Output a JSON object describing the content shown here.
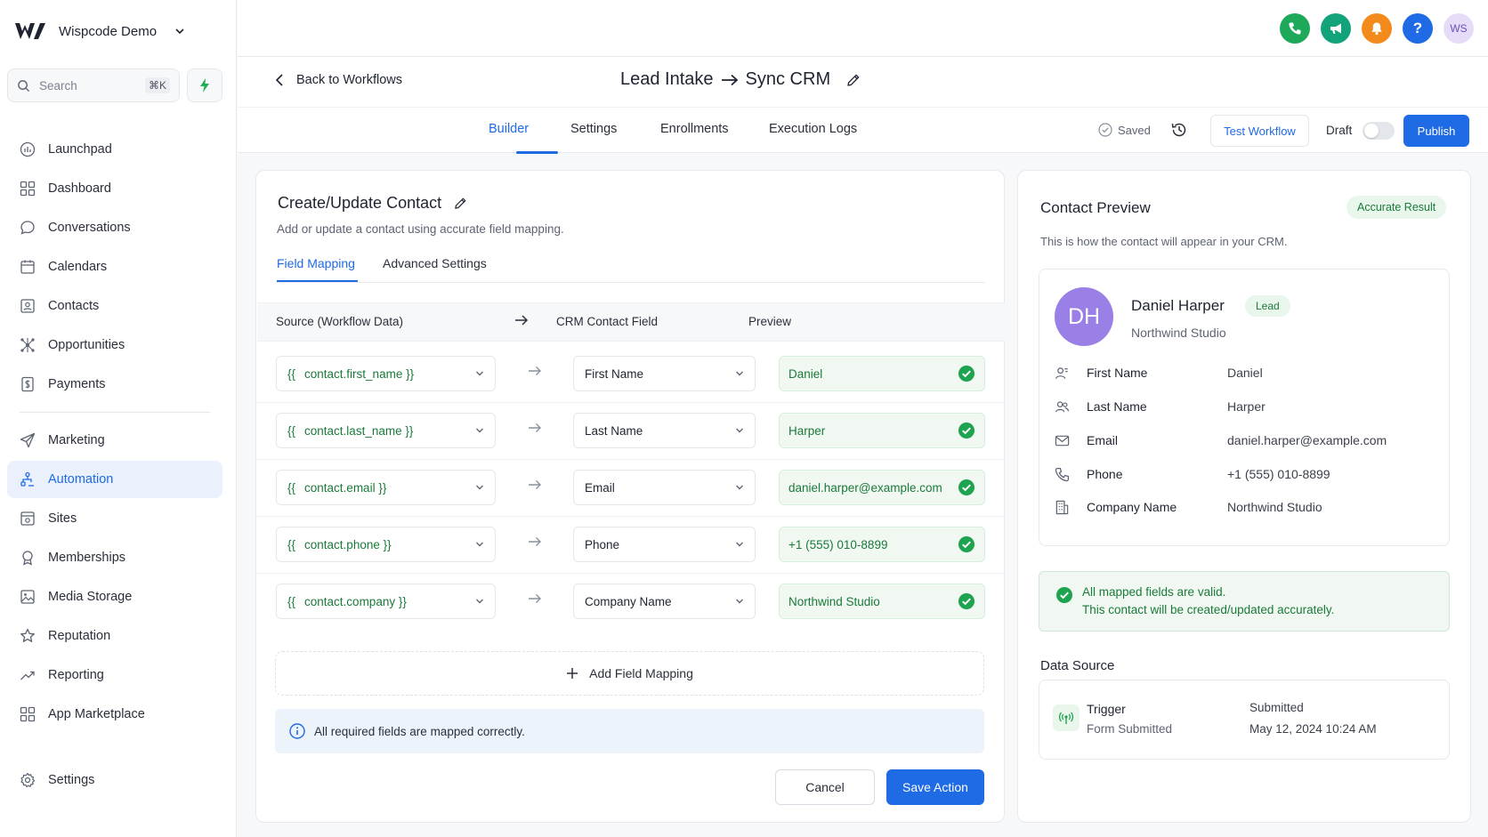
{
  "brand": {
    "name": "Wispcode Demo"
  },
  "search": {
    "placeholder": "Search",
    "shortcut": "⌘K"
  },
  "sidebar": {
    "items": [
      {
        "label": "Launchpad",
        "icon": "rocket-icon"
      },
      {
        "label": "Dashboard",
        "icon": "grid-icon"
      },
      {
        "label": "Conversations",
        "icon": "chat-icon"
      },
      {
        "label": "Calendars",
        "icon": "calendar-icon"
      },
      {
        "label": "Contacts",
        "icon": "contact-card-icon"
      },
      {
        "label": "Opportunities",
        "icon": "network-icon"
      },
      {
        "label": "Payments",
        "icon": "dollar-doc-icon"
      }
    ],
    "items2": [
      {
        "label": "Marketing",
        "icon": "send-icon"
      },
      {
        "label": "Automation",
        "icon": "automation-icon",
        "active": true
      },
      {
        "label": "Sites",
        "icon": "sites-icon"
      },
      {
        "label": "Memberships",
        "icon": "badge-icon"
      },
      {
        "label": "Media Storage",
        "icon": "image-icon"
      },
      {
        "label": "Reputation",
        "icon": "star-icon"
      },
      {
        "label": "Reporting",
        "icon": "trend-icon"
      },
      {
        "label": "App Marketplace",
        "icon": "apps-icon"
      }
    ],
    "settings": "Settings"
  },
  "topbar": {
    "avatar_initials": "WS",
    "colors": {
      "phone": "#1ea85a",
      "megaphone": "#12a37a",
      "bell": "#f38a1c",
      "help": "#1f6ae5"
    }
  },
  "header": {
    "back": "Back to Workflows",
    "title_left": "Lead Intake",
    "title_right": "Sync CRM"
  },
  "tabs": [
    "Builder",
    "Settings",
    "Enrollments",
    "Execution Logs"
  ],
  "toolbar": {
    "saved": "Saved",
    "test": "Test Workflow",
    "draft": "Draft",
    "publish": "Publish"
  },
  "action": {
    "title": "Create/Update Contact",
    "description": "Add or update a contact using accurate field mapping.",
    "subtabs": [
      "Field Mapping",
      "Advanced Settings"
    ],
    "columns": {
      "source": "Source (Workflow Data)",
      "crm": "CRM Contact Field",
      "preview": "Preview"
    },
    "rows": [
      {
        "open": "{{",
        "source": "contact.first_name",
        "close": "}}",
        "field": "First Name",
        "preview": "Daniel"
      },
      {
        "open": "{{",
        "source": "contact.last_name",
        "close": "}}",
        "field": "Last Name",
        "preview": "Harper"
      },
      {
        "open": "{{",
        "source": "contact.email",
        "close": "}}",
        "field": "Email",
        "preview": "daniel.harper@example.com"
      },
      {
        "open": "{{",
        "source": "contact.phone",
        "close": "}}",
        "field": "Phone",
        "preview": "+1 (555) 010-8899"
      },
      {
        "open": "{{",
        "source": "contact.company",
        "close": "}}",
        "field": "Company Name",
        "preview": "Northwind Studio"
      }
    ],
    "add_mapping": "Add Field Mapping",
    "info": "All required fields are mapped correctly.",
    "cancel": "Cancel",
    "save": "Save Action"
  },
  "preview": {
    "title": "Contact Preview",
    "badge": "Accurate Result",
    "description": "This is how the contact will appear in your CRM.",
    "initials": "DH",
    "name": "Daniel Harper",
    "tag": "Lead",
    "company": "Northwind Studio",
    "fields": [
      {
        "key": "First Name",
        "value": "Daniel"
      },
      {
        "key": "Last Name",
        "value": "Harper"
      },
      {
        "key": "Email",
        "value": "daniel.harper@example.com"
      },
      {
        "key": "Phone",
        "value": "+1 (555) 010-8899"
      },
      {
        "key": "Company Name",
        "value": "Northwind Studio"
      }
    ],
    "valid_line1": "All mapped fields are valid.",
    "valid_line2": "This contact will be created/updated accurately.",
    "data_source_title": "Data Source",
    "trigger_key": "Trigger",
    "trigger_value": "Form Submitted",
    "submitted_key": "Submitted",
    "submitted_value": "May 12, 2024 10:24 AM"
  },
  "colors": {
    "accent": "#1f6ae5",
    "success": "#1a7a3a"
  }
}
